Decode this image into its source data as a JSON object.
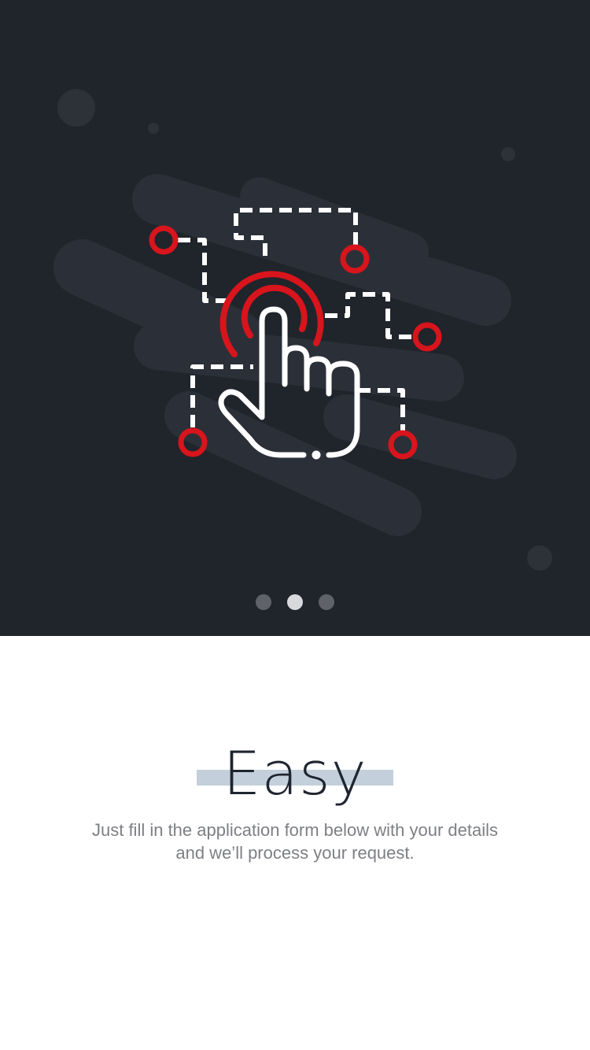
{
  "hero": {
    "illustration_icon": "tap-hand-circuit-icon",
    "colors": {
      "background": "#20242b",
      "accent": "#d8141c",
      "line": "#ffffff"
    }
  },
  "pagination": {
    "count": 3,
    "active_index": 1
  },
  "content": {
    "title": "Easy",
    "body": "Just fill in the application form below with your details and we’ll process your request.",
    "colors": {
      "title": "#1f2530",
      "underline": "#c3d0db",
      "body": "#7d7f83"
    }
  }
}
